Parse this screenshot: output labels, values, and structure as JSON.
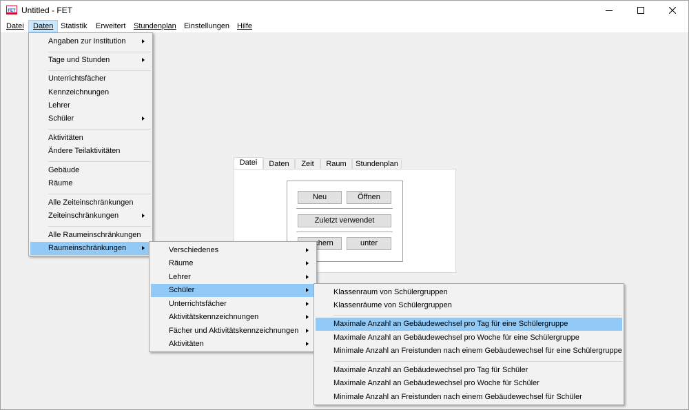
{
  "window": {
    "title": "Untitled - FET",
    "app_icon": "fet-logo-icon",
    "controls": [
      "minimize-icon",
      "maximize-icon",
      "close-icon"
    ]
  },
  "menubar": {
    "items": [
      "Datei",
      "Daten",
      "Statistik",
      "Erweitert",
      "Stundenplan",
      "Einstellungen",
      "Hilfe"
    ]
  },
  "daten_menu": {
    "items": [
      "Angaben zur Institution",
      "Tage und Stunden",
      "Unterrichtsfächer",
      "Kennzeichnungen",
      "Lehrer",
      "Schüler",
      "Aktivitäten",
      "Ändere Teilaktivitäten",
      "Gebäude",
      "Räume",
      "Alle Zeiteinschränkungen",
      "Zeiteinschränkungen",
      "Alle Raumeinschränkungen",
      "Raumeinschränkungen"
    ]
  },
  "raum_menu": {
    "items": [
      "Verschiedenes",
      "Räume",
      "Lehrer",
      "Schüler",
      "Unterrichtsfächer",
      "Aktivitätskennzeichnungen",
      "Fächer und Aktivitätskennzeichnungen",
      "Aktivitäten"
    ]
  },
  "schueler_menu": {
    "items": [
      "Klassenraum von Schülergruppen",
      "Klassenräume von Schülergruppen",
      "Maximale Anzahl an Gebäudewechsel pro Tag für eine Schülergruppe",
      "Maximale Anzahl an Gebäudewechsel pro Woche für eine Schülergruppe",
      "Minimale Anzahl an Freistunden nach einem Gebäudewechsel für eine Schülergruppe",
      "Maximale Anzahl an Gebäudewechsel pro Tag für Schüler",
      "Maximale Anzahl an Gebäudewechsel pro Woche für Schüler",
      "Minimale Anzahl an Freistunden nach einem Gebäudewechsel für Schüler"
    ]
  },
  "tabs": [
    "Datei",
    "Daten",
    "Zeit",
    "Raum",
    "Stundenplan"
  ],
  "panel": {
    "neu": "Neu",
    "oeffnen": "Öffnen",
    "zuletzt": "Zuletzt verwendet",
    "speichern_visible": "chern",
    "unter": "unter"
  },
  "colors": {
    "highlight": "#91c9f7",
    "menubar_active": "#cce8ff"
  }
}
